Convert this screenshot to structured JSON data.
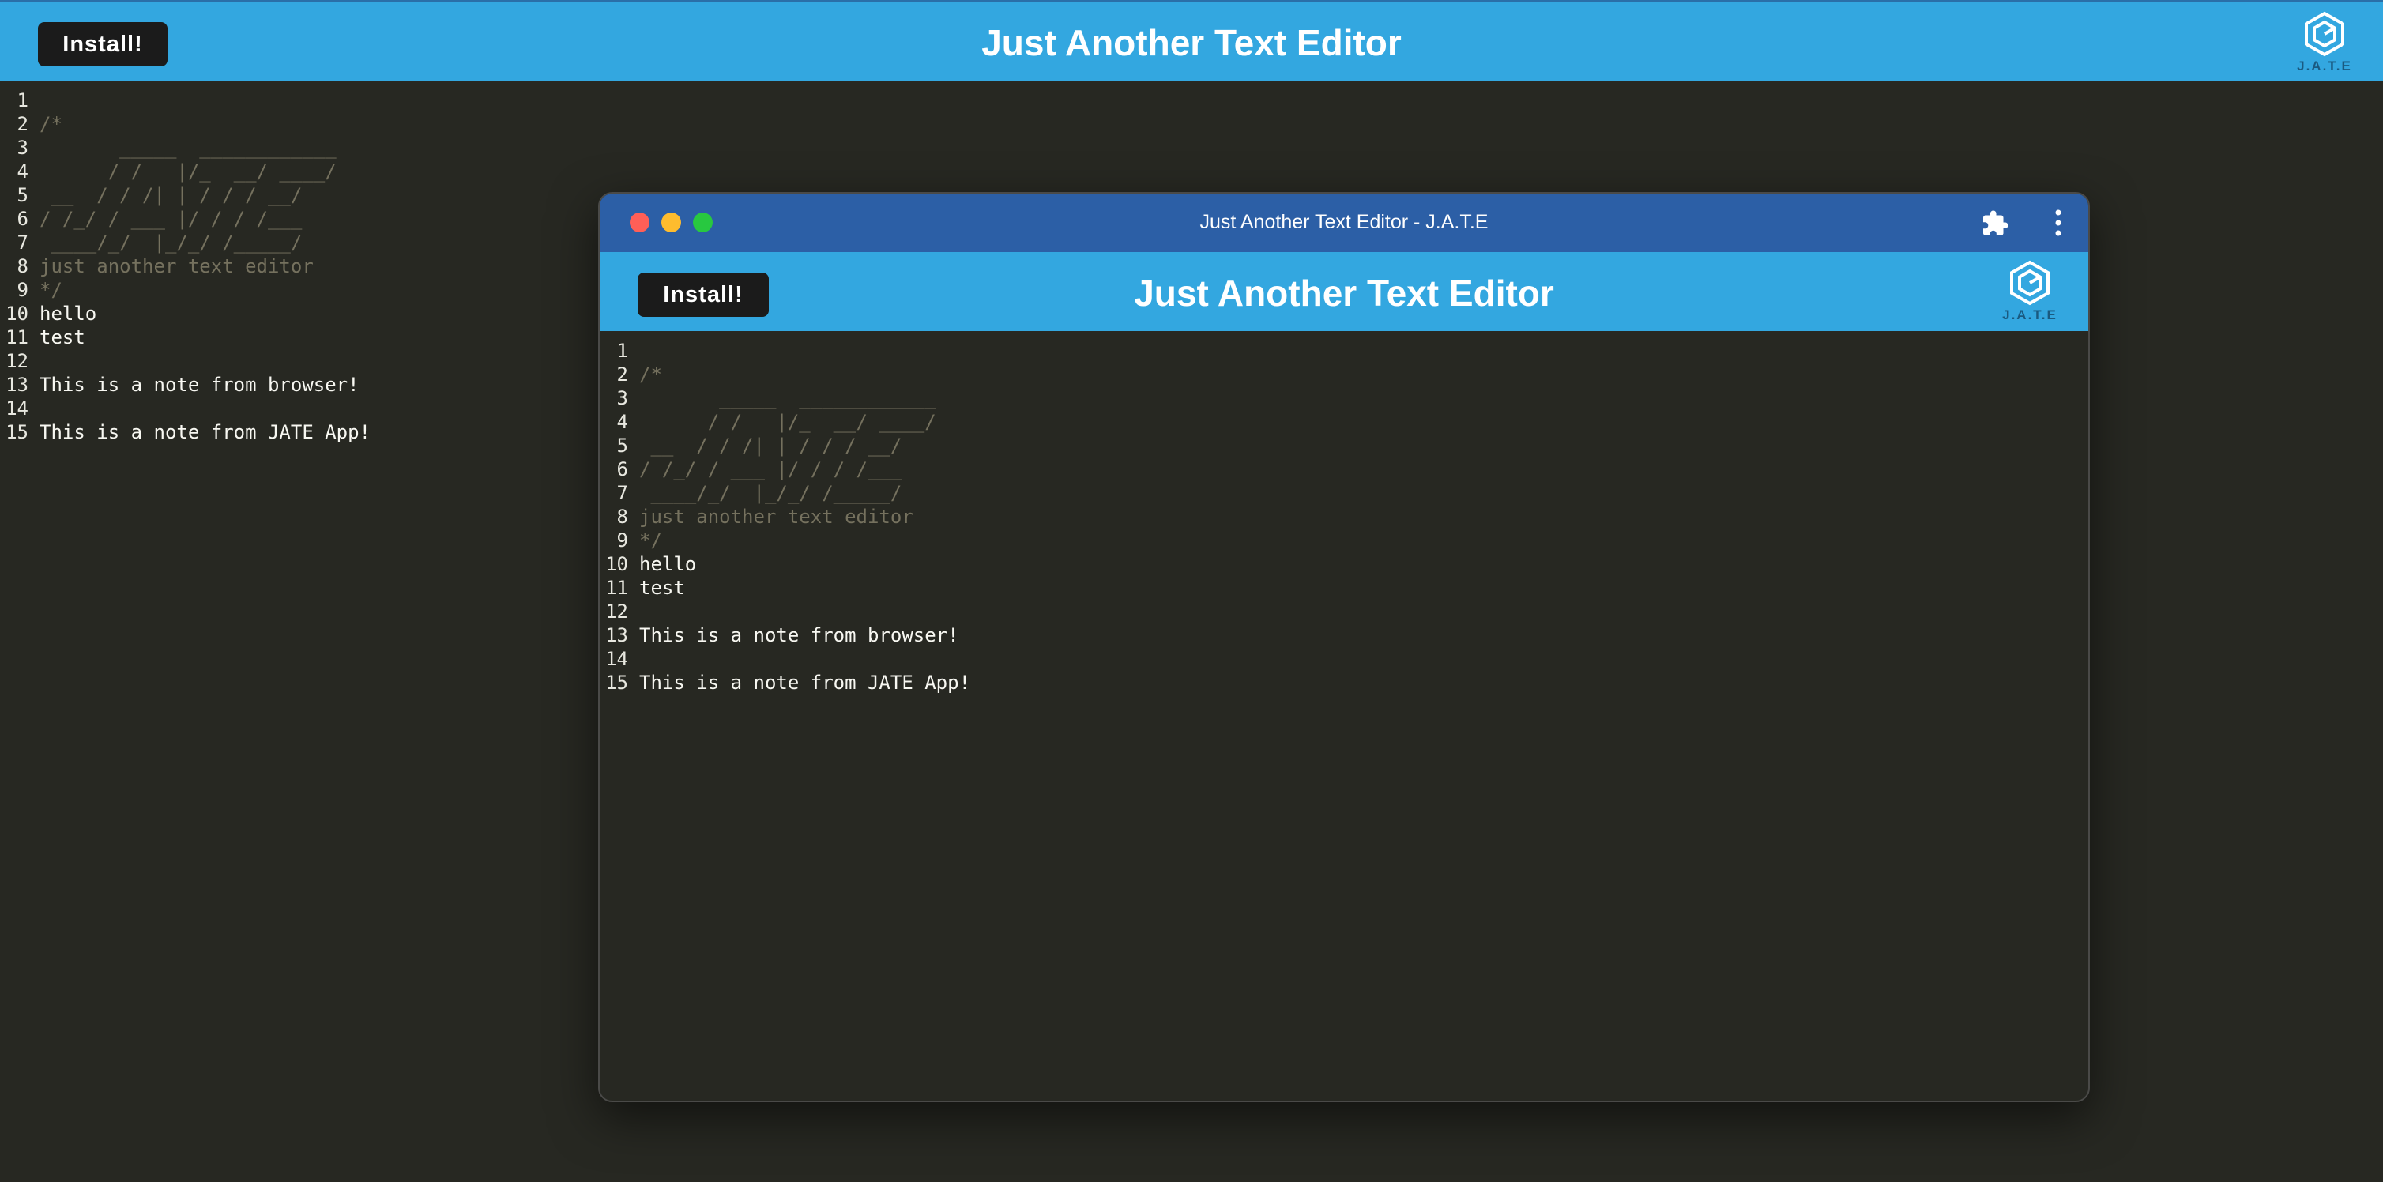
{
  "app": {
    "install_label": "Install!",
    "title": "Just Another Text Editor",
    "logo_text": "J.A.T.E"
  },
  "window": {
    "title": "Just Another Text Editor - J.A.T.E",
    "install_label": "Install!",
    "app_title": "Just Another Text Editor",
    "logo_text": "J.A.T.E"
  },
  "editor": {
    "lines": [
      {
        "n": "1",
        "text": "",
        "style": "normal"
      },
      {
        "n": "2",
        "text": "/*",
        "style": "comment"
      },
      {
        "n": "3",
        "text": "       _____  ____________",
        "style": "comment"
      },
      {
        "n": "4",
        "text": "      / /   |/_  __/ ____/",
        "style": "comment"
      },
      {
        "n": "5",
        "text": " __  / / /| | / / / __/",
        "style": "comment"
      },
      {
        "n": "6",
        "text": "/ /_/ / ___ |/ / / /___",
        "style": "comment"
      },
      {
        "n": "7",
        "text": " ____/_/  |_/_/ /_____/",
        "style": "comment"
      },
      {
        "n": "8",
        "text": "just another text editor",
        "style": "comment"
      },
      {
        "n": "9",
        "text": "*/",
        "style": "comment"
      },
      {
        "n": "10",
        "text": "hello",
        "style": "normal"
      },
      {
        "n": "11",
        "text": "test",
        "style": "normal"
      },
      {
        "n": "12",
        "text": "",
        "style": "normal"
      },
      {
        "n": "13",
        "text": "This is a note from browser!",
        "style": "normal"
      },
      {
        "n": "14",
        "text": "",
        "style": "normal"
      },
      {
        "n": "15",
        "text": "This is a note from JATE App!",
        "style": "normal"
      }
    ]
  },
  "colors": {
    "appbar": "#33a7e0",
    "titlebar": "#2c5fa6",
    "editor_bg": "#272822",
    "comment": "#75715e",
    "text": "#f8f8f2"
  },
  "icons": [
    "jate-logo-icon",
    "extensions-puzzle-icon",
    "more-vert-icon",
    "close-window-dot",
    "minimize-window-dot",
    "zoom-window-dot"
  ]
}
